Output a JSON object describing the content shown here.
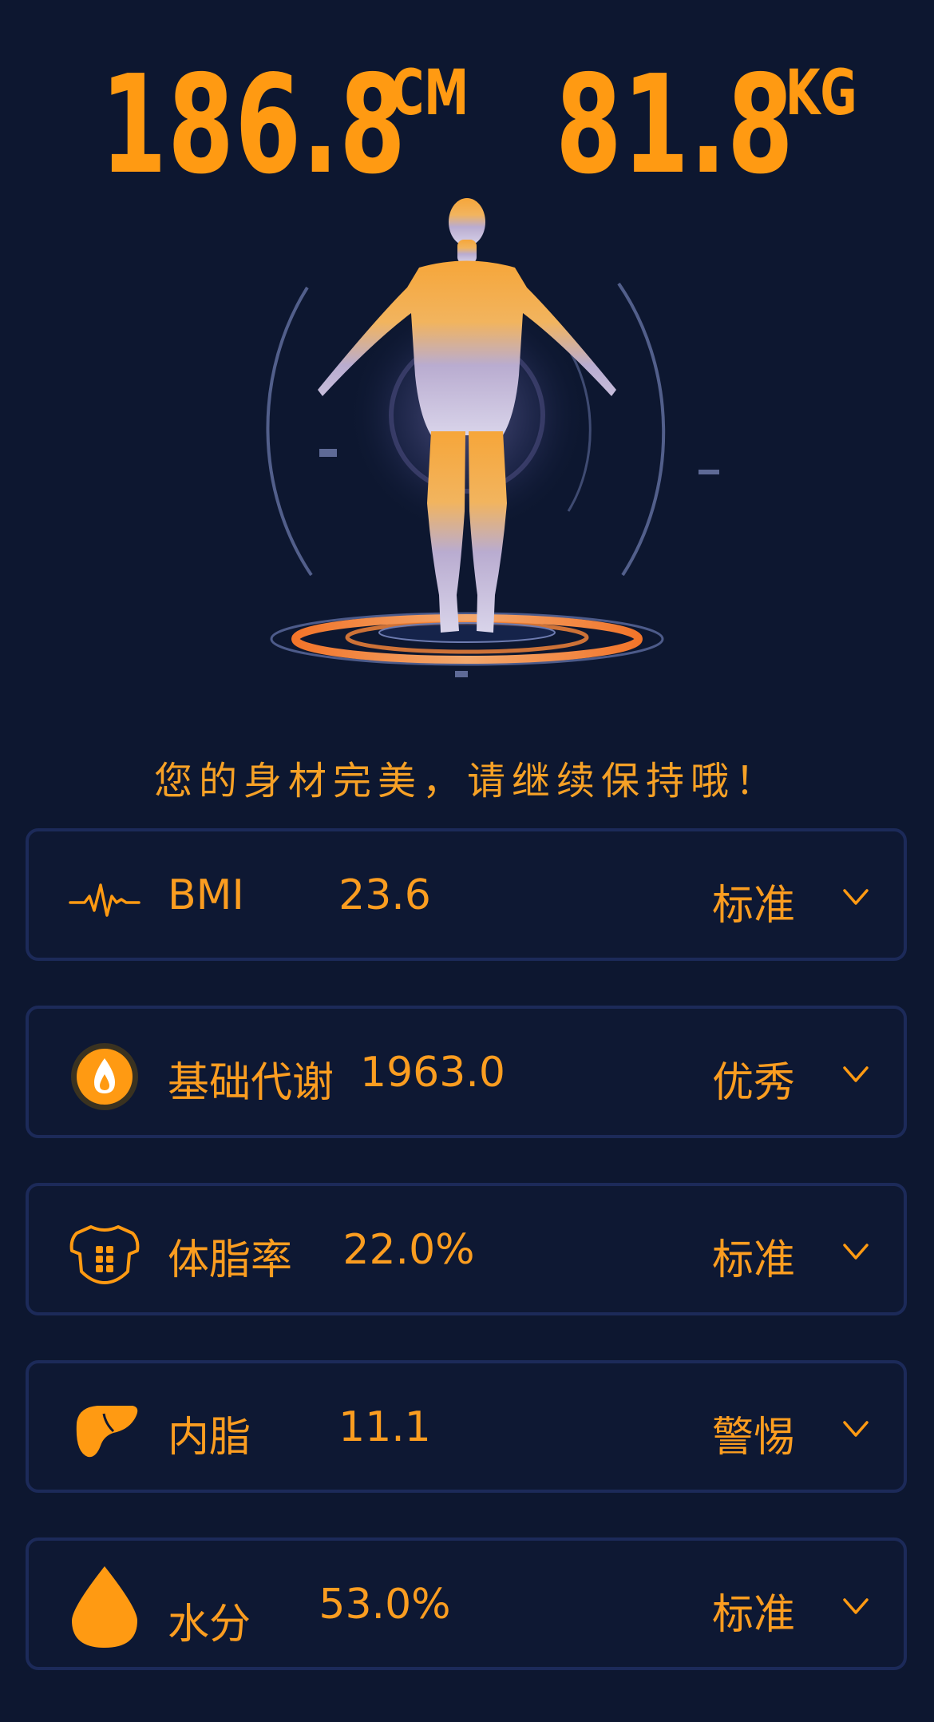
{
  "height": {
    "value": "186.8",
    "unit": "CM"
  },
  "weight": {
    "value": "81.8",
    "unit": "KG"
  },
  "message": "您的身材完美，请继续保持哦！",
  "colors": {
    "accent": "#ff9a12",
    "background": "#0d1730",
    "border": "#1c2a59"
  },
  "metrics": [
    {
      "icon": "heartbeat-icon",
      "label": "BMI",
      "value": "23.6",
      "status": "标准"
    },
    {
      "icon": "metabolism-flame-icon",
      "label": "基础代谢",
      "value": "1963.0",
      "status": "优秀"
    },
    {
      "icon": "body-torso-icon",
      "label": "体脂率",
      "value": "22.0%",
      "status": "标准"
    },
    {
      "icon": "liver-icon",
      "label": "内脂",
      "value": "11.1",
      "status": "警惕"
    },
    {
      "icon": "water-drop-icon",
      "label": "水分",
      "value": "53.0%",
      "status": "标准"
    }
  ]
}
